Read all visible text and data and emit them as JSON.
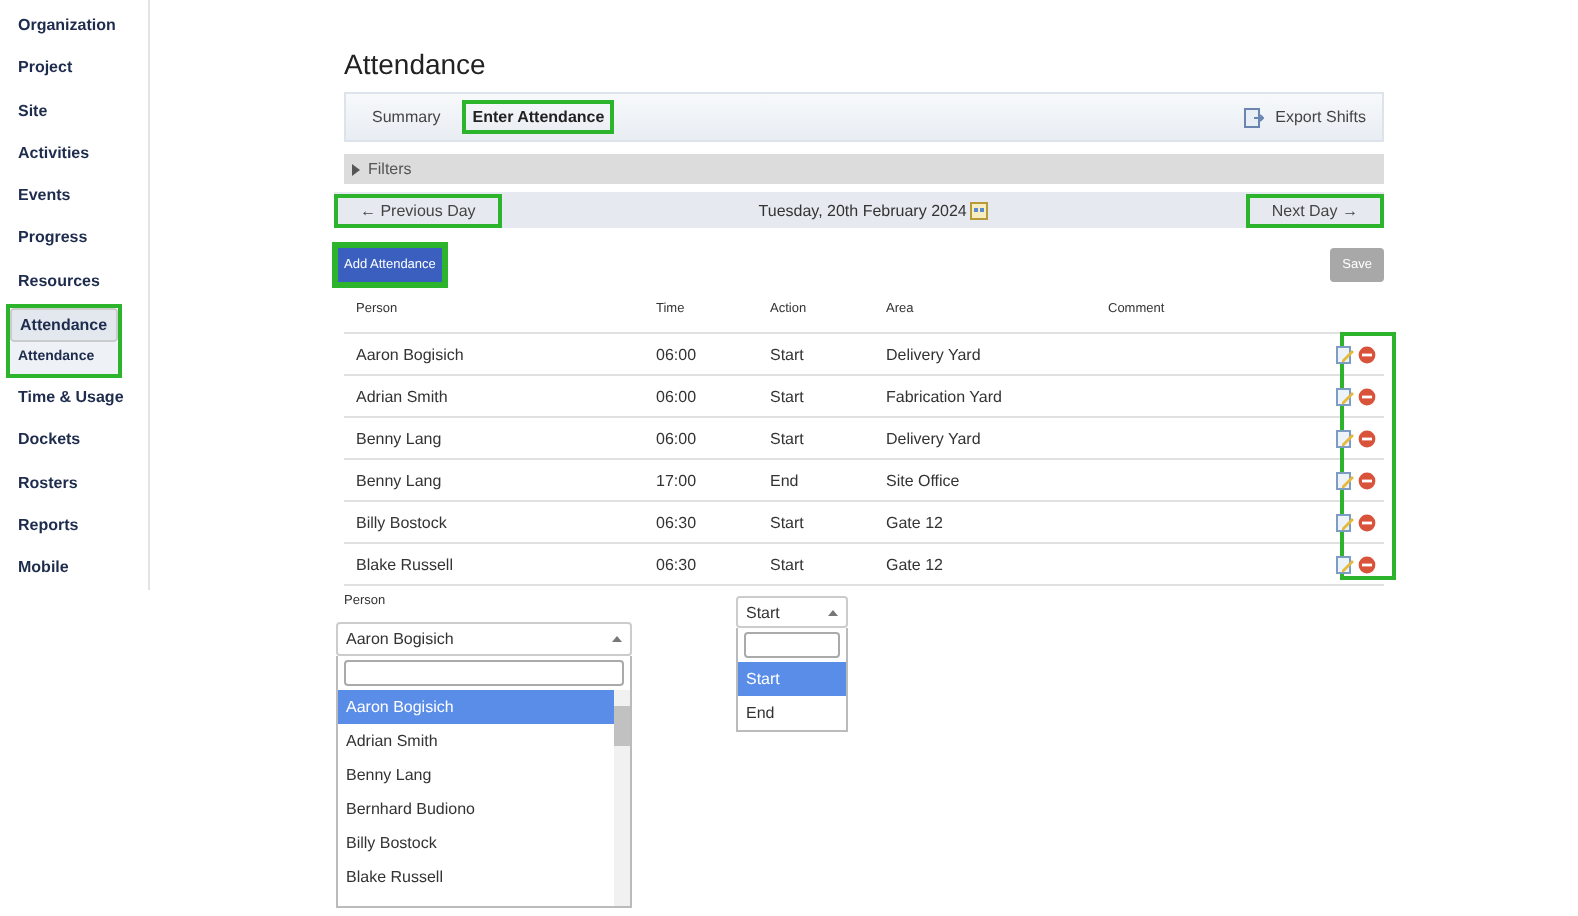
{
  "sidebar": {
    "items": [
      {
        "label": "Organization",
        "selected": false,
        "highlighted": false
      },
      {
        "label": "Project",
        "selected": false,
        "highlighted": false
      },
      {
        "label": "Site",
        "selected": false,
        "highlighted": false
      },
      {
        "label": "Activities",
        "selected": false,
        "highlighted": false
      },
      {
        "label": "Events",
        "selected": false,
        "highlighted": false
      },
      {
        "label": "Progress",
        "selected": false,
        "highlighted": false
      },
      {
        "label": "Resources",
        "selected": false,
        "highlighted": false
      },
      {
        "label": "Attendance",
        "selected": true,
        "highlighted": true,
        "children": [
          {
            "label": "Attendance",
            "selected": true
          }
        ]
      },
      {
        "label": "Time & Usage",
        "selected": false,
        "highlighted": false
      },
      {
        "label": "Dockets",
        "selected": false,
        "highlighted": false
      },
      {
        "label": "Rosters",
        "selected": false,
        "highlighted": false
      },
      {
        "label": "Reports",
        "selected": false,
        "highlighted": false
      },
      {
        "label": "Mobile",
        "selected": false,
        "highlighted": false
      }
    ]
  },
  "page": {
    "title": "Attendance",
    "tabs": [
      {
        "label": "Summary",
        "selected": false,
        "highlighted": false
      },
      {
        "label": "Enter Attendance",
        "selected": true,
        "highlighted": true
      }
    ],
    "export_button": "Export Shifts",
    "filters": {
      "label": "Filters",
      "expanded": false
    },
    "day_nav": {
      "previous": {
        "label": "← Previous Day",
        "highlighted": true
      },
      "date": "Tuesday, 20th February 2024",
      "next": {
        "label": "Next Day →",
        "highlighted": true
      }
    },
    "add_button": {
      "label": "Add Attendance",
      "highlighted": true
    },
    "save_button": {
      "label": "Save",
      "disabled": true
    },
    "table": {
      "columns": [
        "Person",
        "Time",
        "Action",
        "Area",
        "Comment"
      ],
      "actions_highlighted": true,
      "rows": [
        {
          "person": "Aaron Bogisich",
          "time": "06:00",
          "action": "Start",
          "area": "Delivery Yard",
          "comment": ""
        },
        {
          "person": "Adrian Smith",
          "time": "06:00",
          "action": "Start",
          "area": "Fabrication Yard",
          "comment": ""
        },
        {
          "person": "Benny Lang",
          "time": "06:00",
          "action": "Start",
          "area": "Delivery Yard",
          "comment": ""
        },
        {
          "person": "Benny Lang",
          "time": "17:00",
          "action": "End",
          "area": "Site Office",
          "comment": ""
        },
        {
          "person": "Billy Bostock",
          "time": "06:30",
          "action": "Start",
          "area": "Gate 12",
          "comment": ""
        },
        {
          "person": "Blake Russell",
          "time": "06:30",
          "action": "Start",
          "area": "Gate 12",
          "comment": ""
        }
      ]
    }
  },
  "person_dropdown": {
    "label": "Person",
    "value": "Aaron Bogisich",
    "options": [
      {
        "label": "Aaron Bogisich",
        "selected": true
      },
      {
        "label": "Adrian Smith",
        "selected": false
      },
      {
        "label": "Benny Lang",
        "selected": false
      },
      {
        "label": "Bernhard Budiono",
        "selected": false
      },
      {
        "label": "Billy Bostock",
        "selected": false
      },
      {
        "label": "Blake Russell",
        "selected": false
      }
    ]
  },
  "action_dropdown": {
    "value": "Start",
    "options": [
      {
        "label": "Start",
        "selected": true
      },
      {
        "label": "End",
        "selected": false
      }
    ]
  }
}
